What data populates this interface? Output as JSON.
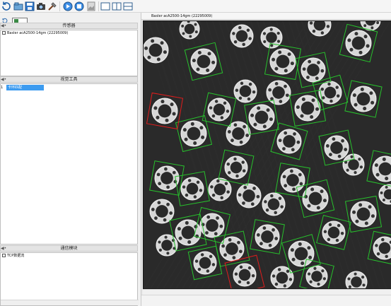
{
  "left": {
    "sensors": {
      "title": "传感器",
      "items": [
        {
          "label": "Basler acA2500-14gm (22295009)"
        }
      ]
    },
    "vision_tools": {
      "title": "视觉工具",
      "selected": {
        "prefix": "1",
        "label": "卡环匹配"
      }
    },
    "comms": {
      "title": "通信模块",
      "items": [
        {
          "label": "TCP数据流"
        }
      ]
    }
  },
  "right": {
    "camera_title": "Basler acA2500-14gm (22295009)"
  },
  "icons": {
    "toolbar": [
      "refresh-icon",
      "open-icon",
      "save-icon",
      "camera-icon",
      "tools-icon",
      "run-icon",
      "stop-icon",
      "gallery-icon",
      "layout-single-icon",
      "layout-split-icon",
      "layout-stack-icon"
    ]
  },
  "colors": {
    "selection": "#3c9bf0",
    "match_ok": "#27c12c",
    "match_ng": "#e11c1c"
  }
}
